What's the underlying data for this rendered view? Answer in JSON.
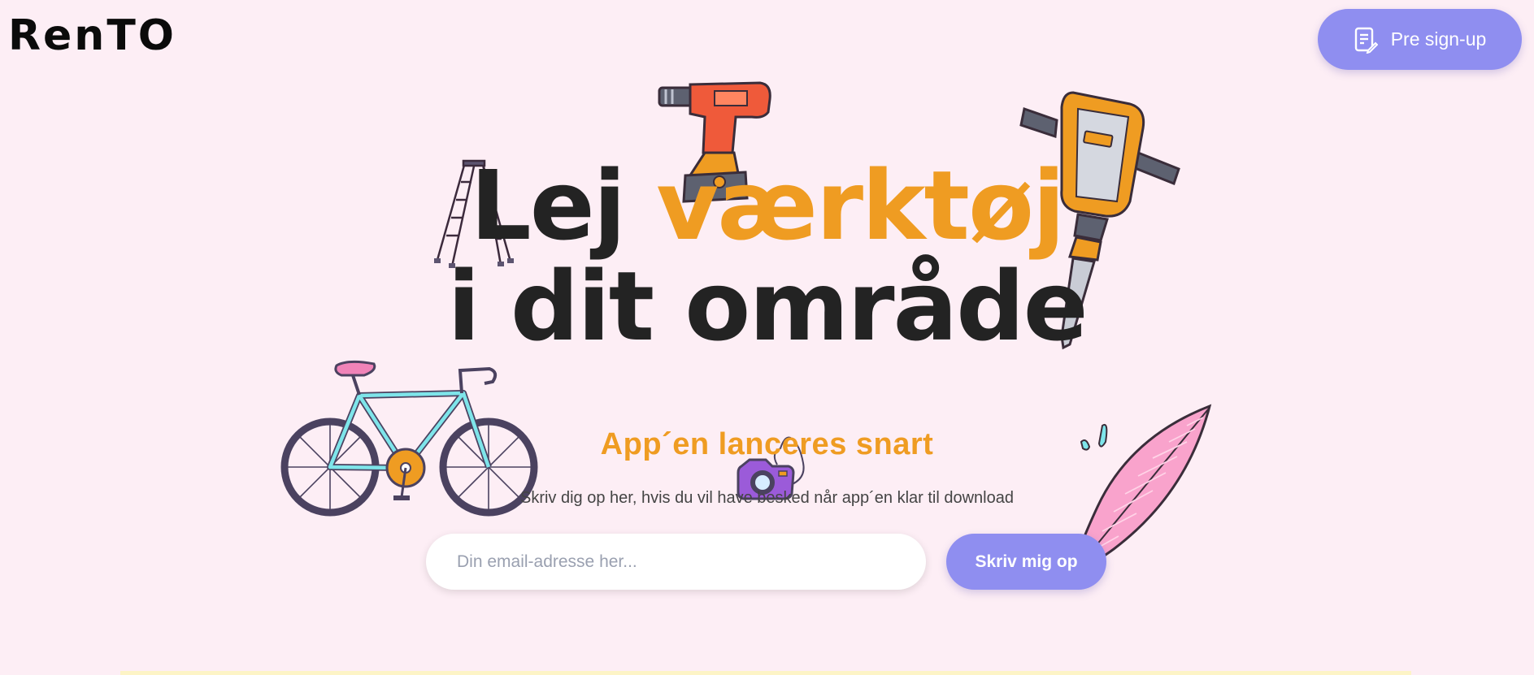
{
  "header": {
    "logo": "RenTO",
    "presignup_label": "Pre sign-up",
    "presignup_icon": "document-edit-icon"
  },
  "hero": {
    "line1_start": "Lej",
    "line1_accent": "værktøj",
    "line2": "i dit område"
  },
  "signup": {
    "subtitle": "App´en lanceres snart",
    "description": "Skriv dig op her, hvis du vil have besked når app´en klar til download",
    "email_placeholder": "Din email-adresse her...",
    "email_value": "",
    "submit_label": "Skriv mig op"
  },
  "illustrations": [
    "drill-icon",
    "ladder-icon",
    "jackhammer-icon",
    "bicycle-icon",
    "camera-icon",
    "surfboard-icon"
  ],
  "colors": {
    "background": "#fdeef5",
    "accent": "#ef9c22",
    "button": "#8f8ef0",
    "text": "#232323"
  }
}
